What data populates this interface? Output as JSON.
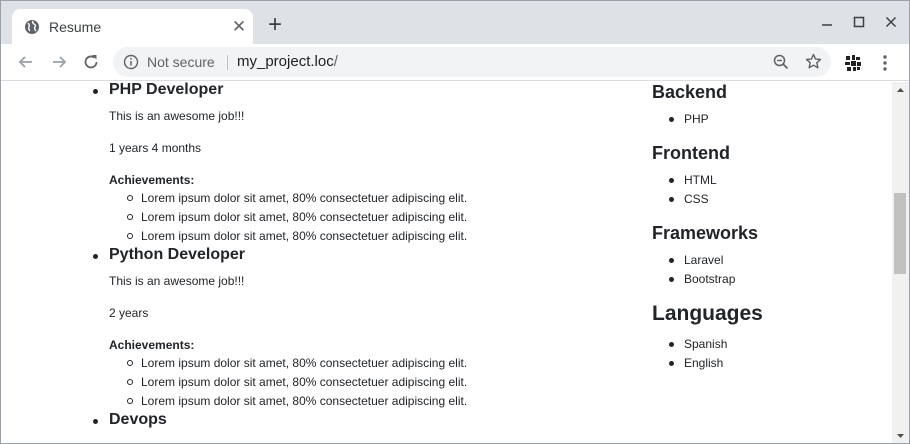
{
  "browser": {
    "tab_title": "Resume",
    "tab_close": "✕",
    "new_tab": "+",
    "security_text": "Not secure",
    "url_host": "my_project.loc",
    "url_path": "/"
  },
  "jobs": [
    {
      "title": "PHP Developer",
      "description": "This is an awesome job!!!",
      "duration": "1 years 4 months",
      "achievements_label": "Achievements:",
      "achievements": [
        "Lorem ipsum dolor sit amet, 80% consectetuer adipiscing elit.",
        "Lorem ipsum dolor sit amet, 80% consectetuer adipiscing elit.",
        "Lorem ipsum dolor sit amet, 80% consectetuer adipiscing elit."
      ]
    },
    {
      "title": "Python Developer",
      "description": "This is an awesome job!!!",
      "duration": "2 years",
      "achievements_label": "Achievements:",
      "achievements": [
        "Lorem ipsum dolor sit amet, 80% consectetuer adipiscing elit.",
        "Lorem ipsum dolor sit amet, 80% consectetuer adipiscing elit.",
        "Lorem ipsum dolor sit amet, 80% consectetuer adipiscing elit."
      ]
    },
    {
      "title": "Devops"
    }
  ],
  "skills": [
    {
      "heading": "Backend",
      "items": [
        "PHP"
      ]
    },
    {
      "heading": "Frontend",
      "items": [
        "HTML",
        "CSS"
      ]
    },
    {
      "heading": "Frameworks",
      "items": [
        "Laravel",
        "Bootstrap"
      ]
    },
    {
      "heading": "Languages",
      "items": [
        "Spanish",
        "English"
      ]
    }
  ],
  "colors": {
    "tabstrip": "#dee1e6",
    "omnibox": "#f1f3f4",
    "text": "#212529"
  }
}
